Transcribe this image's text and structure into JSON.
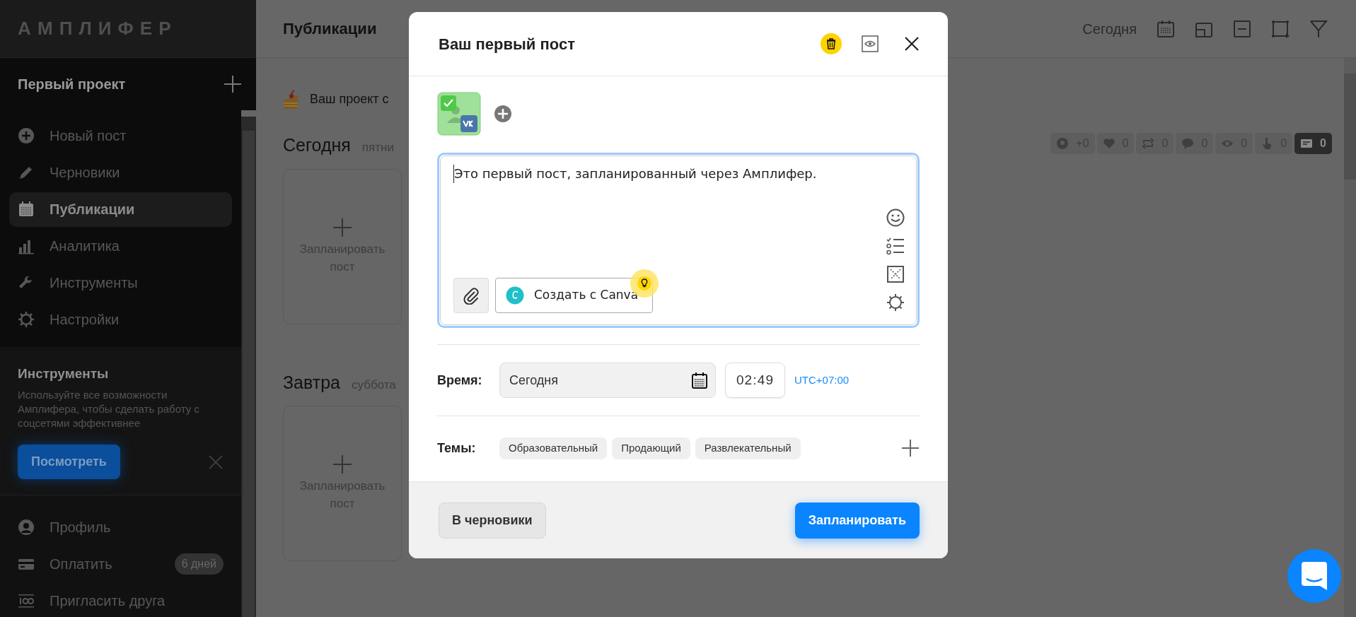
{
  "sidebar": {
    "logo": "АМПЛИФЕР",
    "project": "Первый проект",
    "nav": [
      {
        "kind": "new",
        "label": "Новый пост",
        "selected": false
      },
      {
        "kind": "drafts",
        "label": "Черновики",
        "selected": false
      },
      {
        "kind": "calendar",
        "label": "Публикации",
        "selected": true
      },
      {
        "kind": "analytics",
        "label": "Аналитика",
        "selected": false
      },
      {
        "kind": "tools",
        "label": "Инструменты",
        "selected": false
      },
      {
        "kind": "settings",
        "label": "Настройки",
        "selected": false
      }
    ],
    "promo": {
      "title": "Инструменты",
      "text": "Используйте все возможности Амплифера, чтобы сделать работу с соцсетями эффективнее",
      "button": "Посмотреть"
    },
    "footer_nav": [
      {
        "kind": "profile",
        "label": "Профиль"
      },
      {
        "kind": "pay",
        "label": "Оплатить",
        "badge": "6 дней"
      },
      {
        "kind": "invite",
        "label": "Пригласить друга"
      }
    ]
  },
  "header": {
    "title": "Публикации",
    "today": "Сегодня"
  },
  "banner": "Ваш проект с",
  "days": [
    {
      "title": "Сегодня",
      "weekday": "пятни",
      "card": "Запланировать пост"
    },
    {
      "title": "Завтра",
      "weekday": "суббота",
      "card": "Запланировать пост"
    }
  ],
  "stats": [
    {
      "kind": "followers",
      "value": "+0",
      "selected": false
    },
    {
      "kind": "likes",
      "value": "0",
      "selected": false
    },
    {
      "kind": "reposts",
      "value": "0",
      "selected": false
    },
    {
      "kind": "comments",
      "value": "0",
      "selected": false
    },
    {
      "kind": "views",
      "value": "0",
      "selected": false
    },
    {
      "kind": "clicks",
      "value": "0",
      "selected": false
    },
    {
      "kind": "posts",
      "value": "0",
      "selected": true
    }
  ],
  "modal": {
    "title": "Ваш первый пост",
    "post_text": "Это первый пост, запланированный через Амплифер.",
    "canva_button": "Создать с Canva",
    "time_label": "Время:",
    "date": "Сегодня",
    "time": "02:49",
    "timezone": "UTC+07:00",
    "topics_label": "Темы:",
    "topics": [
      "Образовательный",
      "Продающий",
      "Развлекательный"
    ],
    "draft_button": "В черновики",
    "schedule_button": "Запланировать"
  }
}
